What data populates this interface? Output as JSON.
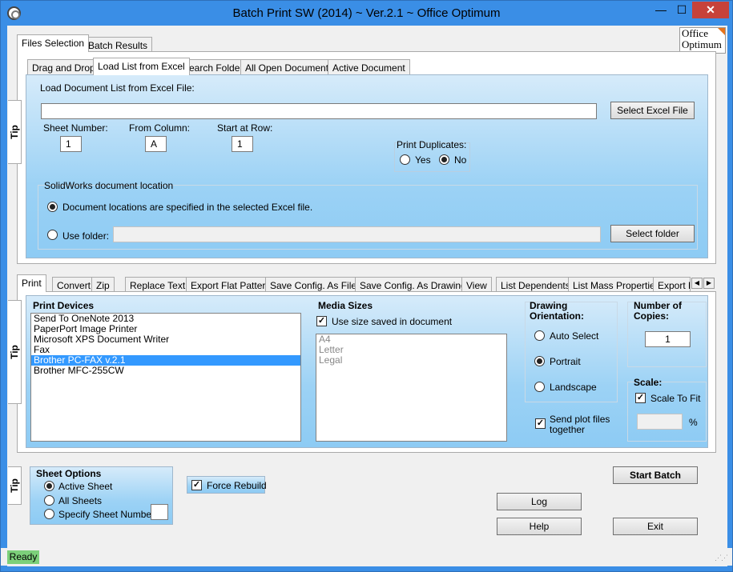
{
  "window": {
    "title": "Batch Print SW (2014) ~ Ver.2.1 ~ Office Optimum"
  },
  "controls": {
    "minimize": "—",
    "maximize": "☐",
    "close": "✕"
  },
  "logo": {
    "line1": "Office",
    "line2": "Optimum"
  },
  "top_tabs": [
    "Files Selection",
    "Batch Results"
  ],
  "source_tabs": [
    "Drag and Drop",
    "Load List from Excel",
    "Search Folder",
    "All Open Documents",
    "Active Document"
  ],
  "excel": {
    "heading": "Load Document List from Excel File:",
    "file_path": "",
    "select_file_button": "Select Excel File",
    "sheet_label": "Sheet Number:",
    "sheet_value": "1",
    "column_label": "From Column:",
    "column_value": "A",
    "row_label": "Start at Row:",
    "row_value": "1",
    "duplicates_label": "Print Duplicates:",
    "dup_yes": "Yes",
    "dup_no": "No",
    "location_heading": "SolidWorks document location",
    "location_option_excel": "Document locations are specified in the selected Excel file.",
    "location_option_folder": "Use folder:",
    "folder_value": "",
    "select_folder_button": "Select folder"
  },
  "tip_label": "Tip",
  "action_tabs": [
    "Print",
    "Convert",
    "Zip",
    "Replace Text",
    "Export Flat Pattern",
    "Save Config. As Files",
    "Save Config. As Drawings",
    "View",
    "List Dependents",
    "List Mass Properties",
    "Export B"
  ],
  "print": {
    "devices_heading": "Print Devices",
    "devices": [
      "Send To OneNote 2013",
      "PaperPort Image Printer",
      "Microsoft XPS Document Writer",
      "Fax",
      "Brother PC-FAX v.2.1",
      "Brother MFC-255CW"
    ],
    "selected_device": 4,
    "media_heading": "Media Sizes",
    "use_saved_size": "Use size saved in document",
    "media": [
      "A4",
      "Letter",
      "Legal"
    ],
    "orientation_heading_1": "Drawing",
    "orientation_heading_2": "Orientation:",
    "orient_auto": "Auto Select",
    "orient_portrait": "Portrait",
    "orient_landscape": "Landscape",
    "copies_heading_1": "Number of",
    "copies_heading_2": "Copies:",
    "copies_value": "1",
    "scale_heading": "Scale:",
    "scale_to_fit": "Scale To Fit",
    "scale_value": "",
    "percent": "%",
    "send_plot_1": "Send plot files",
    "send_plot_2": "together"
  },
  "sheet": {
    "heading": "Sheet Options",
    "active": "Active Sheet",
    "all": "All Sheets",
    "specify": "Specify Sheet Number:",
    "specify_value": "",
    "force_rebuild": "Force Rebuild"
  },
  "buttons": {
    "start": "Start Batch",
    "log": "Log",
    "help": "Help",
    "exit": "Exit"
  },
  "status": {
    "text": "Ready"
  }
}
